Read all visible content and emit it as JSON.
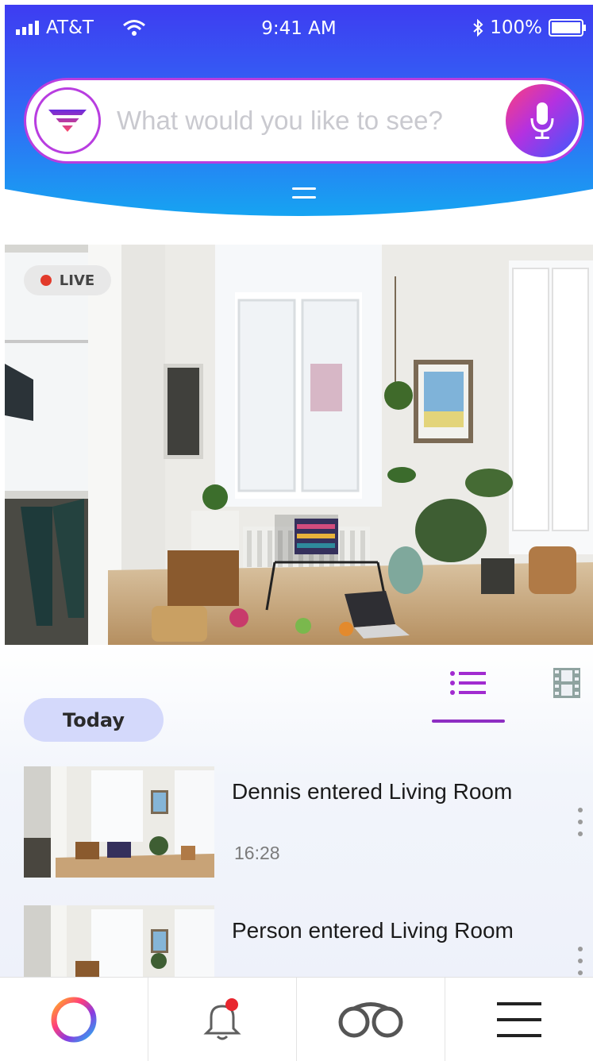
{
  "status_bar": {
    "carrier": "AT&T",
    "time": "9:41 AM",
    "battery": "100%",
    "icons": [
      "signal-icon",
      "wifi-icon",
      "bluetooth-icon",
      "battery-icon"
    ]
  },
  "search": {
    "placeholder": "What would you like to see?",
    "filter_icon": "filter-icon",
    "mic_icon": "microphone-icon"
  },
  "live_view": {
    "badge": "LIVE"
  },
  "view_toggle": {
    "list_icon": "list-view-icon",
    "film_icon": "film-strip-icon",
    "active": "list"
  },
  "date_chip": "Today",
  "events": [
    {
      "title": "Dennis entered Living Room",
      "time": "16:28"
    },
    {
      "title": "Person entered Living Room",
      "time": ""
    }
  ],
  "bottom_nav": {
    "items": [
      "home-ring-icon",
      "notifications-bell-icon",
      "binoculars-icon",
      "menu-icon"
    ],
    "notification_badge": true
  },
  "colors": {
    "header_gradient_start": "#3e3cf2",
    "header_gradient_end": "#16a4f2",
    "accent_purple": "#b83de0",
    "tab_underline": "#8d2ec2",
    "live_dot": "#e23a2a",
    "chip_bg": "#d4d9fb"
  }
}
